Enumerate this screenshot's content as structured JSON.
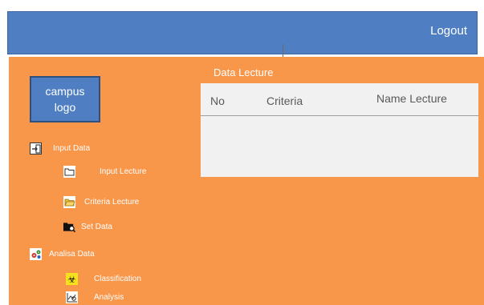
{
  "header": {
    "logout_label": "Logout"
  },
  "logo": {
    "line1": "campus",
    "line2": "logo"
  },
  "sidebar": {
    "items": [
      {
        "label": "Input Data",
        "icon": "input-icon"
      },
      {
        "label": "Input Lecture",
        "icon": "folder-icon"
      },
      {
        "label": "Criteria Lecture",
        "icon": "folder-open-icon"
      },
      {
        "label": "Set Data",
        "icon": "folder-search-icon"
      },
      {
        "label": "Analisa Data",
        "icon": "gears-icon"
      },
      {
        "label": "Classification",
        "icon": "biohazard-icon"
      },
      {
        "label": "Analysis",
        "icon": "chart-search-icon"
      }
    ]
  },
  "panel": {
    "title": "Data Lecture",
    "columns": [
      "No",
      "Criteria",
      "Name Lecture"
    ]
  }
}
